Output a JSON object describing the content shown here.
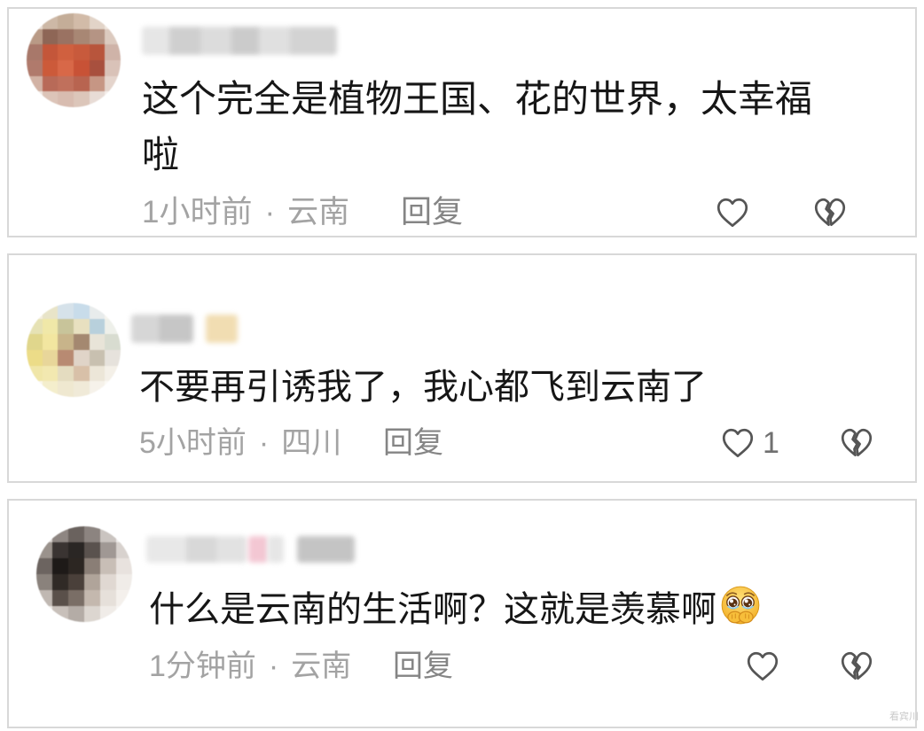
{
  "separator": "·",
  "watermark": "看宾川",
  "icons": {
    "like": "heart-outline-icon",
    "dislike": "broken-heart-icon",
    "emoji": "teary-face-hands-emoji-icon"
  },
  "colors": {
    "text": "#161616",
    "meta": "#a3a3a3",
    "reply": "#858585",
    "icon": "#555555",
    "border": "#d8d8d8"
  },
  "comments": [
    {
      "text": "这个完全是植物王国、花的世界，太幸福啦",
      "time": "1小时前",
      "location": "云南",
      "reply_label": "回复",
      "avatar_mosaic": [
        [
          "#e8dcd2",
          "#cdb8a6",
          "#c4ad98",
          "#d2bba8",
          "#e2d4c8",
          "#efe6de"
        ],
        [
          "#b99a86",
          "#8e6656",
          "#9a7262",
          "#a88774",
          "#b59484",
          "#dccabf"
        ],
        [
          "#a8786a",
          "#c4563a",
          "#d0603f",
          "#c85a3c",
          "#b8553c",
          "#cfb3a8"
        ],
        [
          "#b07a6c",
          "#cc5a3a",
          "#d86848",
          "#c85236",
          "#a8503e",
          "#d9c2b8"
        ],
        [
          "#d2b2a4",
          "#b86a58",
          "#c0705c",
          "#b86450",
          "#c69684",
          "#e4d4cc"
        ],
        [
          "#efe6e0",
          "#dcc4b8",
          "#d8bcb0",
          "#dcc6ba",
          "#e8dcd6",
          "#f4eeea"
        ]
      ]
    },
    {
      "text": "不要再引诱我了，我心都飞到云南了",
      "time": "5小时前",
      "location": "四川",
      "reply_label": "回复",
      "like_count": "1",
      "avatar_mosaic": [
        [
          "#f4efe0",
          "#e8e4c8",
          "#d6e2ea",
          "#c8dcea",
          "#e8ecec",
          "#f6f4ee"
        ],
        [
          "#e6e2b4",
          "#f0e8a8",
          "#c8c49a",
          "#e8e0c0",
          "#b8d0dc",
          "#eef0ea"
        ],
        [
          "#e0d68c",
          "#f2e6a0",
          "#c8b48a",
          "#a48870",
          "#e8e4d8",
          "#d8dcd0"
        ],
        [
          "#ecdc88",
          "#e8d69a",
          "#b88a72",
          "#e0d4c8",
          "#c8c0b0",
          "#e6e2dc"
        ],
        [
          "#f0e6a8",
          "#f2e8b0",
          "#e4dcc0",
          "#d8c0a8",
          "#ece6d8",
          "#f4f0e8"
        ],
        [
          "#faf6ea",
          "#f4eecc",
          "#efe8d0",
          "#f0ead8",
          "#f6f2ea",
          "#fbf9f4"
        ]
      ]
    },
    {
      "text": "什么是云南的生活啊？这就是羡慕啊",
      "time": "1分钟前",
      "location": "云南",
      "reply_label": "回复",
      "avatar_mosaic": [
        [
          "#dcd6d2",
          "#8e8682",
          "#6a625e",
          "#8c8480",
          "#cac4c0",
          "#f0eeec"
        ],
        [
          "#9a928c",
          "#3a3432",
          "#2a2624",
          "#5a524e",
          "#a09894",
          "#d8d2ce"
        ],
        [
          "#6c6460",
          "#1e1a18",
          "#2c2622",
          "#8a7e76",
          "#c8beb6",
          "#e8e2de"
        ],
        [
          "#8a827c",
          "#302a26",
          "#4a403a",
          "#b0a49a",
          "#e0d8d2",
          "#f0ece8"
        ],
        [
          "#c0b8b2",
          "#5a504a",
          "#7a6e66",
          "#c4b8ae",
          "#e6e0da",
          "#f4f0ec"
        ],
        [
          "#ece8e4",
          "#c8c0ba",
          "#b4aca6",
          "#dcd6d0",
          "#f0ece8",
          "#f8f6f4"
        ]
      ]
    }
  ]
}
